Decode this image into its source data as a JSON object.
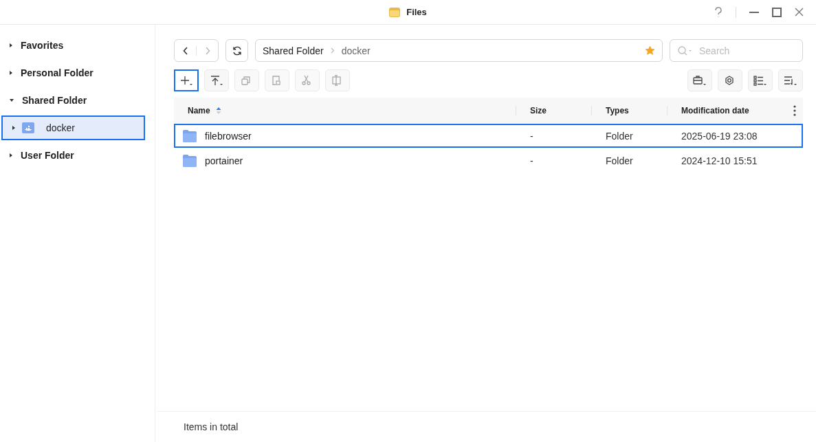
{
  "window": {
    "title": "Files"
  },
  "sidebar": {
    "items": [
      {
        "label": "Favorites",
        "expanded": false,
        "selected": false
      },
      {
        "label": "Personal Folder",
        "expanded": false,
        "selected": false
      },
      {
        "label": "Shared Folder",
        "expanded": true,
        "selected": false,
        "children": [
          {
            "label": "docker",
            "expanded": false,
            "selected": true
          }
        ]
      },
      {
        "label": "User Folder",
        "expanded": false,
        "selected": false
      }
    ]
  },
  "path": {
    "segments": [
      "Shared Folder",
      "docker"
    ],
    "favorite": true
  },
  "search": {
    "placeholder": "Search"
  },
  "toolbar_left": [
    {
      "kind": "create",
      "disabled": false,
      "focused": true
    },
    {
      "kind": "upload",
      "disabled": false,
      "focused": false
    },
    {
      "kind": "copy",
      "disabled": true,
      "focused": false
    },
    {
      "kind": "paste",
      "disabled": true,
      "focused": false
    },
    {
      "kind": "cut",
      "disabled": true,
      "focused": false
    },
    {
      "kind": "rename",
      "disabled": true,
      "focused": false
    }
  ],
  "toolbar_right": [
    {
      "kind": "tools"
    },
    {
      "kind": "settings"
    },
    {
      "kind": "view"
    },
    {
      "kind": "sort"
    }
  ],
  "table": {
    "columns": [
      {
        "label": "Name",
        "sorted": true
      },
      {
        "label": "Size",
        "sorted": false
      },
      {
        "label": "Types",
        "sorted": false
      },
      {
        "label": "Modification date",
        "sorted": false
      }
    ],
    "rows": [
      {
        "name": "filebrowser",
        "size": "-",
        "type": "Folder",
        "modified": "2025-06-19 23:08",
        "selected": true
      },
      {
        "name": "portainer",
        "size": "-",
        "type": "Folder",
        "modified": "2024-12-10 15:51",
        "selected": false
      }
    ]
  },
  "status_bar": {
    "text": "Items in total"
  }
}
